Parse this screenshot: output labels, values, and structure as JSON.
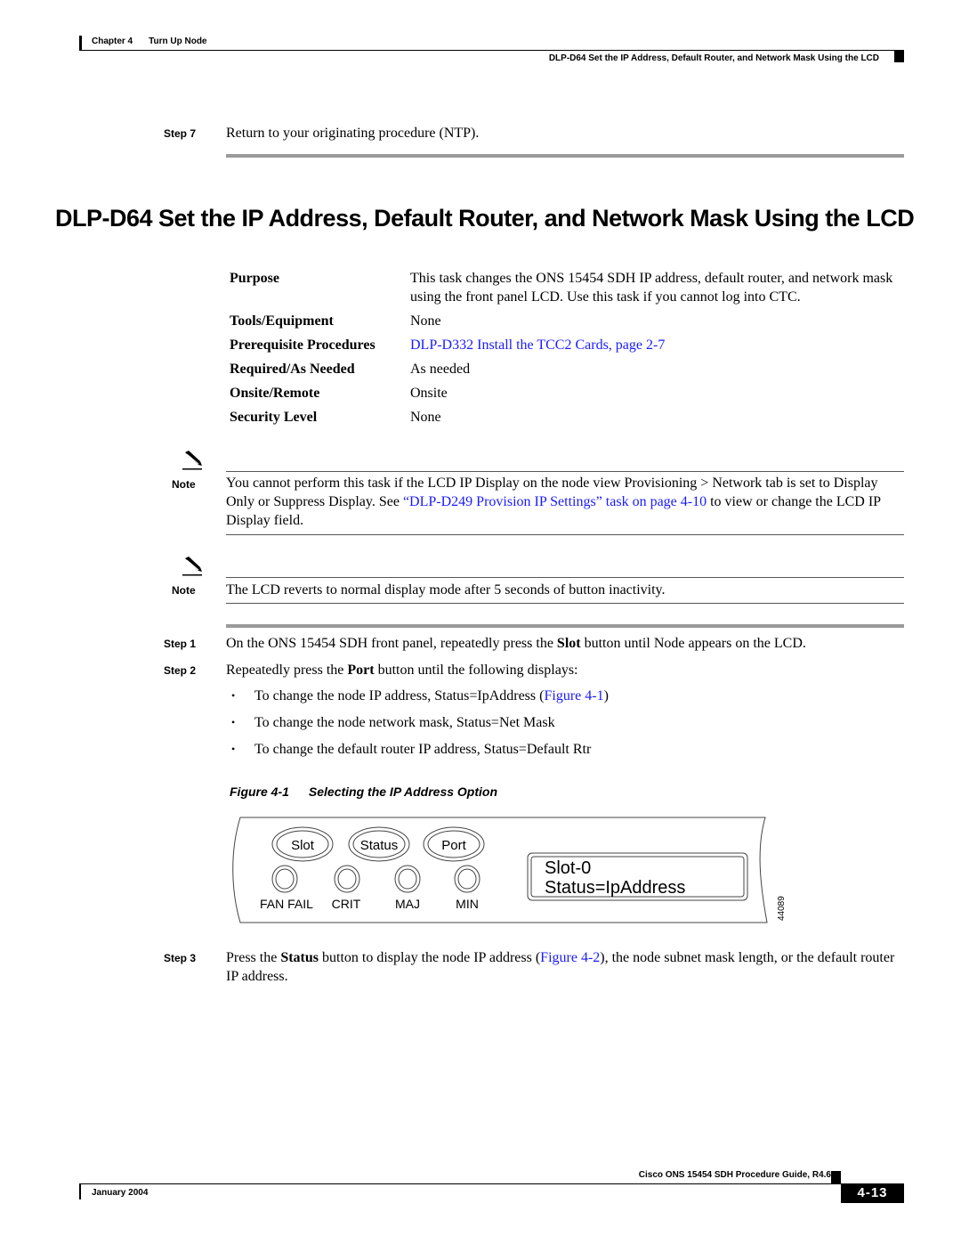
{
  "header": {
    "chapter": "Chapter 4",
    "chapter_title": "Turn Up Node",
    "section": "DLP-D64 Set the IP Address, Default Router, and Network Mask Using the LCD"
  },
  "prev_step": {
    "label": "Step 7",
    "text": "Return to your originating procedure (NTP)."
  },
  "title": "DLP-D64 Set the IP Address, Default Router, and Network Mask Using the LCD",
  "purpose_table": [
    {
      "label": "Purpose",
      "value": "This task changes the ONS 15454 SDH IP address, default router, and network mask using the front panel LCD. Use this task if you cannot log into CTC.",
      "is_link": false
    },
    {
      "label": "Tools/Equipment",
      "value": "None",
      "is_link": false
    },
    {
      "label": "Prerequisite Procedures",
      "value": "DLP-D332 Install the TCC2 Cards, page 2-7",
      "is_link": true
    },
    {
      "label": "Required/As Needed",
      "value": "As needed",
      "is_link": false
    },
    {
      "label": "Onsite/Remote",
      "value": "Onsite",
      "is_link": false
    },
    {
      "label": "Security Level",
      "value": "None",
      "is_link": false
    }
  ],
  "notes": [
    {
      "label": "Note",
      "icon": "pencil-note-icon",
      "text_before": "You cannot perform this task if the LCD IP Display on the node view Provisioning > Network tab is set to Display Only or Suppress Display. See ",
      "link": "“DLP-D249 Provision IP Settings” task on page 4-10",
      "text_after": " to view or change the LCD IP Display field."
    },
    {
      "label": "Note",
      "icon": "pencil-note-icon",
      "text": "The LCD reverts to normal display mode after 5 seconds of button inactivity."
    }
  ],
  "steps": [
    {
      "label": "Step 1",
      "before": "On the ONS 15454 SDH front panel, repeatedly press the ",
      "bold": "Slot",
      "after": " button until Node appears on the LCD."
    },
    {
      "label": "Step 2",
      "before": "Repeatedly press the ",
      "bold": "Port",
      "after": " button until the following displays:",
      "bullets": [
        {
          "text": "To change the node IP address, Status=IpAddress (",
          "link": "Figure 4-1",
          "after": ")"
        },
        {
          "text": "To change the node network mask, Status=Net Mask"
        },
        {
          "text": "To change the default router IP address, Status=Default Rtr"
        }
      ]
    },
    {
      "label": "Step 3",
      "before": "Press the ",
      "bold": "Status",
      "after_before_link": " button to display the node IP address (",
      "link": "Figure 4-2",
      "after": "), the node subnet mask length, or the default router IP address."
    }
  ],
  "figure": {
    "number": "Figure 4-1",
    "caption": "Selecting the IP Address Option",
    "buttons": [
      "Slot",
      "Status",
      "Port"
    ],
    "leds": [
      "FAN FAIL",
      "CRIT",
      "MAJ",
      "MIN"
    ],
    "lcd_lines": [
      "Slot-0",
      "Status=IpAddress"
    ],
    "figure_id": "44089"
  },
  "footer": {
    "guide_title": "Cisco ONS 15454 SDH Procedure Guide, R4.6",
    "date": "January 2004",
    "page": "4-13"
  }
}
